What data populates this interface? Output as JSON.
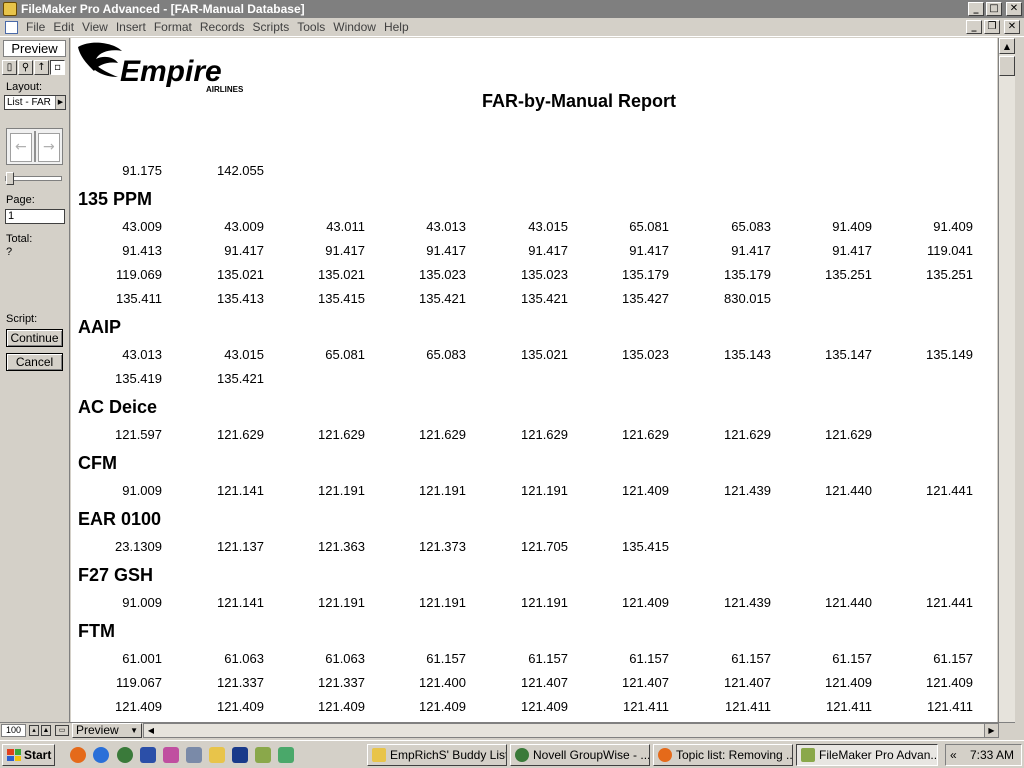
{
  "window": {
    "title": "FileMaker Pro Advanced - [FAR-Manual Database]"
  },
  "menu": [
    "File",
    "Edit",
    "View",
    "Insert",
    "Format",
    "Records",
    "Scripts",
    "Tools",
    "Window",
    "Help"
  ],
  "status_area": {
    "mode": "Preview",
    "layout_label": "Layout:",
    "layout_value": "List - FAR",
    "page_label": "Page:",
    "page_value": "1",
    "total_label": "Total:",
    "total_value": "?",
    "script_label": "Script:",
    "continue_label": "Continue",
    "cancel_label": "Cancel"
  },
  "logo": {
    "name": "Empire",
    "sub": "AIRLINES"
  },
  "report": {
    "title": "FAR-by-Manual Report",
    "carryover": [
      "91.175",
      "142.055"
    ],
    "groups": [
      {
        "name": "135 PPM",
        "rows": [
          [
            "43.009",
            "43.009",
            "43.011",
            "43.013",
            "43.015",
            "65.081",
            "65.083",
            "91.409",
            "91.409"
          ],
          [
            "91.413",
            "91.417",
            "91.417",
            "91.417",
            "91.417",
            "91.417",
            "91.417",
            "91.417",
            "119.041"
          ],
          [
            "119.069",
            "135.021",
            "135.021",
            "135.023",
            "135.023",
            "135.179",
            "135.179",
            "135.251",
            "135.251"
          ],
          [
            "135.411",
            "135.413",
            "135.415",
            "135.421",
            "135.421",
            "135.427",
            "830.015"
          ]
        ]
      },
      {
        "name": "AAIP",
        "rows": [
          [
            "43.013",
            "43.015",
            "65.081",
            "65.083",
            "135.021",
            "135.023",
            "135.143",
            "135.147",
            "135.149"
          ],
          [
            "135.419",
            "135.421"
          ]
        ]
      },
      {
        "name": "AC Deice",
        "rows": [
          [
            "121.597",
            "121.629",
            "121.629",
            "121.629",
            "121.629",
            "121.629",
            "121.629",
            "121.629"
          ]
        ]
      },
      {
        "name": "CFM",
        "rows": [
          [
            "91.009",
            "121.141",
            "121.191",
            "121.191",
            "121.191",
            "121.409",
            "121.439",
            "121.440",
            "121.441"
          ]
        ]
      },
      {
        "name": "EAR 0100",
        "rows": [
          [
            "23.1309",
            "121.137",
            "121.363",
            "121.373",
            "121.705",
            "135.415"
          ]
        ]
      },
      {
        "name": "F27 GSH",
        "rows": [
          [
            "91.009",
            "121.141",
            "121.191",
            "121.191",
            "121.191",
            "121.409",
            "121.439",
            "121.440",
            "121.441"
          ]
        ]
      },
      {
        "name": "FTM",
        "rows": [
          [
            "61.001",
            "61.063",
            "61.063",
            "61.157",
            "61.157",
            "61.157",
            "61.157",
            "61.157",
            "61.157"
          ],
          [
            "119.067",
            "121.337",
            "121.337",
            "121.400",
            "121.407",
            "121.407",
            "121.407",
            "121.409",
            "121.409"
          ],
          [
            "121.409",
            "121.409",
            "121.409",
            "121.409",
            "121.409",
            "121.411",
            "121.411",
            "121.411",
            "121.411"
          ]
        ]
      }
    ]
  },
  "bottom_bar": {
    "zoom": "100",
    "mode": "Preview"
  },
  "taskbar": {
    "start_label": "Start",
    "tasks": [
      {
        "label": "EmpRichS' Buddy List...",
        "icon": "buddy-list-icon",
        "active": false
      },
      {
        "label": "Novell GroupWise - ...",
        "icon": "groupwise-icon",
        "active": false
      },
      {
        "label": "Topic list: Removing ...",
        "icon": "firefox-icon",
        "active": false
      },
      {
        "label": "FileMaker Pro Advan...",
        "icon": "filemaker-icon",
        "active": true
      }
    ],
    "tray_chevron": "«",
    "clock": "7:33 AM"
  },
  "colors": {
    "title_bar_inactive": "#7f7f7f",
    "chrome": "#d4d0c8",
    "page_background": "#ffffff"
  }
}
